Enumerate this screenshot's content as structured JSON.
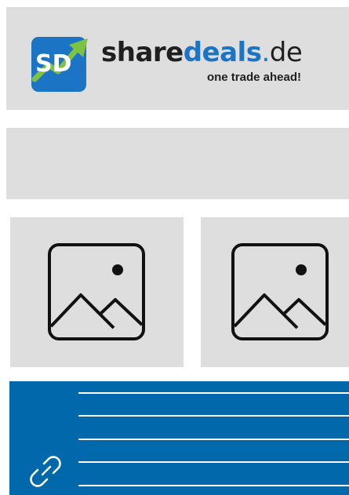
{
  "header": {
    "logo": {
      "mark_text": "SD",
      "wordmark_part1": "share",
      "wordmark_part2": "deals",
      "wordmark_dot": ".",
      "wordmark_tld": "de",
      "tagline": "one trade ahead!",
      "colors": {
        "blue": "#1b74c4",
        "green": "#7ec242",
        "dark": "#1f1f1f"
      }
    }
  },
  "placeholders": [
    {
      "icon": "image-placeholder-icon"
    },
    {
      "icon": "image-placeholder-icon"
    }
  ],
  "link_panel": {
    "icon": "link-icon",
    "background": "#0068ab",
    "line_count": 5
  },
  "colors": {
    "placeholder_bg": "#dedede",
    "link_panel_bg": "#0068ab"
  }
}
